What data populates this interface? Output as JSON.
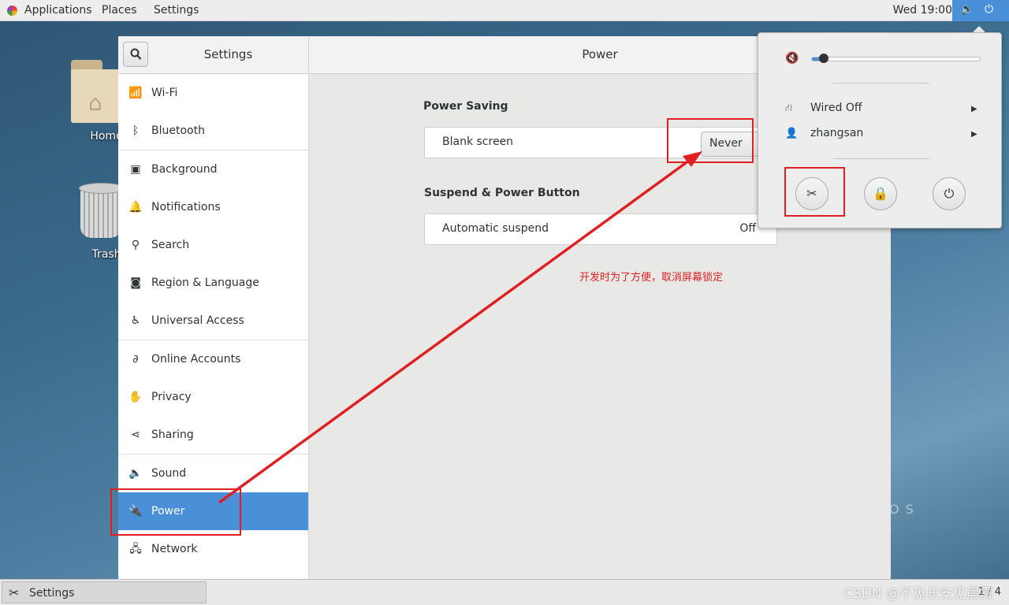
{
  "topbar": {
    "applications": "Applications",
    "places": "Places",
    "settings": "Settings",
    "clock": "Wed 19:00"
  },
  "desktop": {
    "home_label": "Home",
    "trash_label": "Trash",
    "os_text": "OS"
  },
  "sidebar": {
    "title": "Settings",
    "items": [
      {
        "label": "Wi-Fi",
        "icon": "wifi-icon"
      },
      {
        "label": "Bluetooth",
        "icon": "bluetooth-icon"
      },
      {
        "label": "Background",
        "icon": "background-icon"
      },
      {
        "label": "Notifications",
        "icon": "bell-icon"
      },
      {
        "label": "Search",
        "icon": "search-icon"
      },
      {
        "label": "Region & Language",
        "icon": "camera-icon"
      },
      {
        "label": "Universal Access",
        "icon": "accessibility-icon"
      },
      {
        "label": "Online Accounts",
        "icon": "online-accounts-icon"
      },
      {
        "label": "Privacy",
        "icon": "hand-icon"
      },
      {
        "label": "Sharing",
        "icon": "share-icon"
      },
      {
        "label": "Sound",
        "icon": "speaker-icon"
      },
      {
        "label": "Power",
        "icon": "power-plug-icon"
      },
      {
        "label": "Network",
        "icon": "network-icon"
      }
    ]
  },
  "main": {
    "title": "Power",
    "power_saving_title": "Power Saving",
    "blank_screen_label": "Blank screen",
    "blank_screen_value": "Never",
    "suspend_title": "Suspend & Power Button",
    "auto_suspend_label": "Automatic suspend",
    "auto_suspend_value": "Off",
    "annotation_note": "开发时为了方便，取消屏幕锁定"
  },
  "system_menu": {
    "volume_level": 0.07,
    "wired_label": "Wired Off",
    "user_label": "zhangsan"
  },
  "bottombar": {
    "task_label": "Settings",
    "pager": "1 / 4"
  },
  "watermark": "CSDN @不见长安见晨雾",
  "colors": {
    "accent": "#4a90d9",
    "annotation": "#e02020"
  }
}
